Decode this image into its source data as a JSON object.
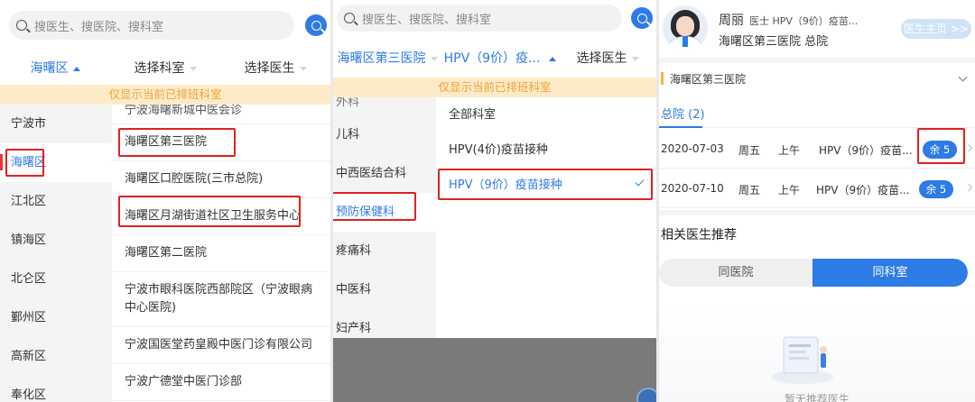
{
  "search": {
    "placeholder": "搜医生、搜医院、搜科室"
  },
  "notice": "仅显示当前已排班科室",
  "colors": {
    "accent": "#2d7be5",
    "highlight_box": "#e02020",
    "notice_bg": "#fdebc8",
    "notice_text": "#f0a43a"
  },
  "panel1": {
    "filters": {
      "district": "海曙区",
      "dept": "选择科室",
      "doctor": "选择医生"
    },
    "districts": [
      "宁波市",
      "海曙区",
      "江北区",
      "镇海区",
      "北仑区",
      "鄞州区",
      "高新区",
      "奉化区"
    ],
    "hospitals": [
      "宁波海曙新城中医会诊",
      "海曙区第三医院",
      "海曙区口腔医院(三市总院)",
      "海曙区月湖街道社区卫生服务中心",
      "海曙区第二医院",
      "宁波市眼科医院西部院区（宁波眼病中心医院)",
      "宁波国医堂药皇殿中医门诊有限公司",
      "宁波广德堂中医门诊部"
    ]
  },
  "panel2": {
    "filters": {
      "hospital": "海曙区第三医院",
      "dept": "HPV（9价）疫...",
      "doctor": "选择医生"
    },
    "depts": [
      "外科",
      "儿科",
      "中西医结合科",
      "预防保健科",
      "疼痛科",
      "中医科",
      "妇产科"
    ],
    "subdepts": [
      "全部科室",
      "HPV(4价)疫苗接种",
      "HPV（9价）疫苗接种"
    ]
  },
  "panel3": {
    "doctor_name": "周丽",
    "doctor_title": "医士 HPV（9价）疫苗...",
    "doctor_hospital": "海曙区第三医院 总院",
    "home_button": "医生主页 >>",
    "hospital_select": "海曙区第三医院",
    "tab": "总院 (2)",
    "slots": [
      {
        "date": "2020-07-03",
        "weekday": "周五",
        "period": "上午",
        "item": "HPV（9价）疫苗...",
        "remain": "余 5"
      },
      {
        "date": "2020-07-10",
        "weekday": "周五",
        "period": "上午",
        "item": "HPV（9价）疫苗...",
        "remain": "余 5"
      }
    ],
    "recommend_title": "相关医生推荐",
    "seg_same_hospital": "同医院",
    "seg_same_dept": "同科室",
    "empty_text": "暂无推荐医生"
  }
}
